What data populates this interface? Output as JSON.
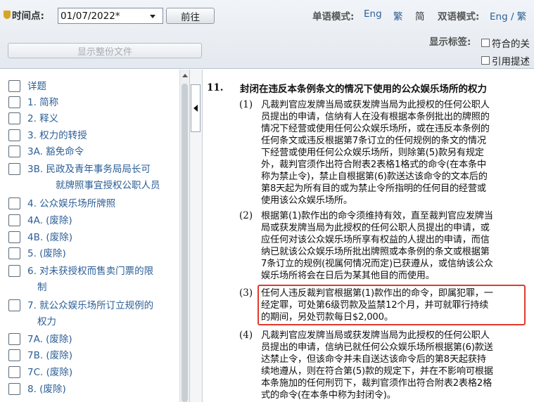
{
  "toolbar": {
    "date_label": "时间点:",
    "date_value": "01/07/2022*",
    "go_label": "前往",
    "single_mode_label": "单语模式:",
    "single_eng": "Eng",
    "single_trad": "繁",
    "single_simp": "简",
    "dual_mode_label": "双语模式:",
    "dual_option": "Eng / 繁",
    "pdf_button": "显示整份文件",
    "show_tags_label": "显示标签:",
    "tag_option_1": "符合的关",
    "tag_option_2": "引用提述"
  },
  "toc": {
    "items": [
      {
        "label": "详题"
      },
      {
        "label": "1. 简称"
      },
      {
        "label": "2. 释义"
      },
      {
        "label": "3. 权力的转授"
      },
      {
        "label": "3A. 豁免命令"
      },
      {
        "label": "3B. 民政及青年事务局局长可",
        "label2": "就牌照事宜授权公职人员"
      },
      {
        "label": "4. 公众娱乐场所牌照"
      },
      {
        "label": "4A. (废除)"
      },
      {
        "label": "4B. (废除)"
      },
      {
        "label": "5. (废除)"
      },
      {
        "label": "6. 对未获授权而售卖门票的限",
        "label2": "制"
      },
      {
        "label": "7. 就公众娱乐场所订立规例的",
        "label2": "权力"
      },
      {
        "label": "7A. (废除)"
      },
      {
        "label": "7B. (废除)"
      },
      {
        "label": "7C. (废除)"
      },
      {
        "label": "8. (废除)"
      }
    ]
  },
  "content": {
    "section_number": "11.",
    "section_title": "封闭在违反本条例条文的情况下使用的公众娱乐场所的权力",
    "subsections": [
      {
        "num": "(1)",
        "lines": [
          "凡裁判官应发牌当局或获发牌当局为此授权的任何公职人",
          "员提出的申请，信纳有人在没有根据本条例批出的牌照的",
          "情况下经营或使用任何公众娱乐场所，或在违反本条例的",
          "任何条文或违反根据第7条订立的任何规例的条文的情况",
          "下经营或使用任何公众娱乐场所，则除第(5)款另有规定",
          "外，裁判官须作出符合附表2表格1格式的命令(在本条中",
          "称为禁止令)，禁止自根据第(6)款送达该命令的文本后的",
          "第8天起为所有目的或为禁止令所指明的任何目的经营或",
          "使用该公众娱乐场所。"
        ]
      },
      {
        "num": "(2)",
        "lines": [
          "根据第(1)款作出的命令须维持有效，直至裁判官应发牌当",
          "局或获发牌当局为此授权的任何公职人员提出的申请，或",
          "应任何对该公众娱乐场所享有权益的人提出的申请，而信",
          "纳已就该公众娱乐场所批出牌照或本条例的条文或根据第",
          "7条订立的规例(视属何情况而定)已获遵从，或信纳该公众",
          "娱乐场所将会在日后为某其他目的而使用。"
        ]
      },
      {
        "num": "(3)",
        "lines": [
          "任何人违反裁判官根据第(1)款作出的命令，即属犯罪，一",
          "经定罪，可处第6级罚款及监禁12个月，并可就罪行持续",
          "的期间，另处罚款每日$2,000。"
        ]
      },
      {
        "num": "(4)",
        "lines": [
          "凡裁判官应发牌当局或获发牌当局为此授权的任何公职人",
          "员提出的申请，信纳已就任何公众娱乐场所根据第(6)款送",
          "达禁止令，但该命令并未自送达该命令后的第8天起获持",
          "续地遵从，则在符合第(5)款的规定下，并在不影响可根据",
          "本条施加的任何刑罚下，裁判官须作出符合附表2表格2格",
          "式的命令(在本条中称为封闭令)。"
        ]
      }
    ]
  }
}
